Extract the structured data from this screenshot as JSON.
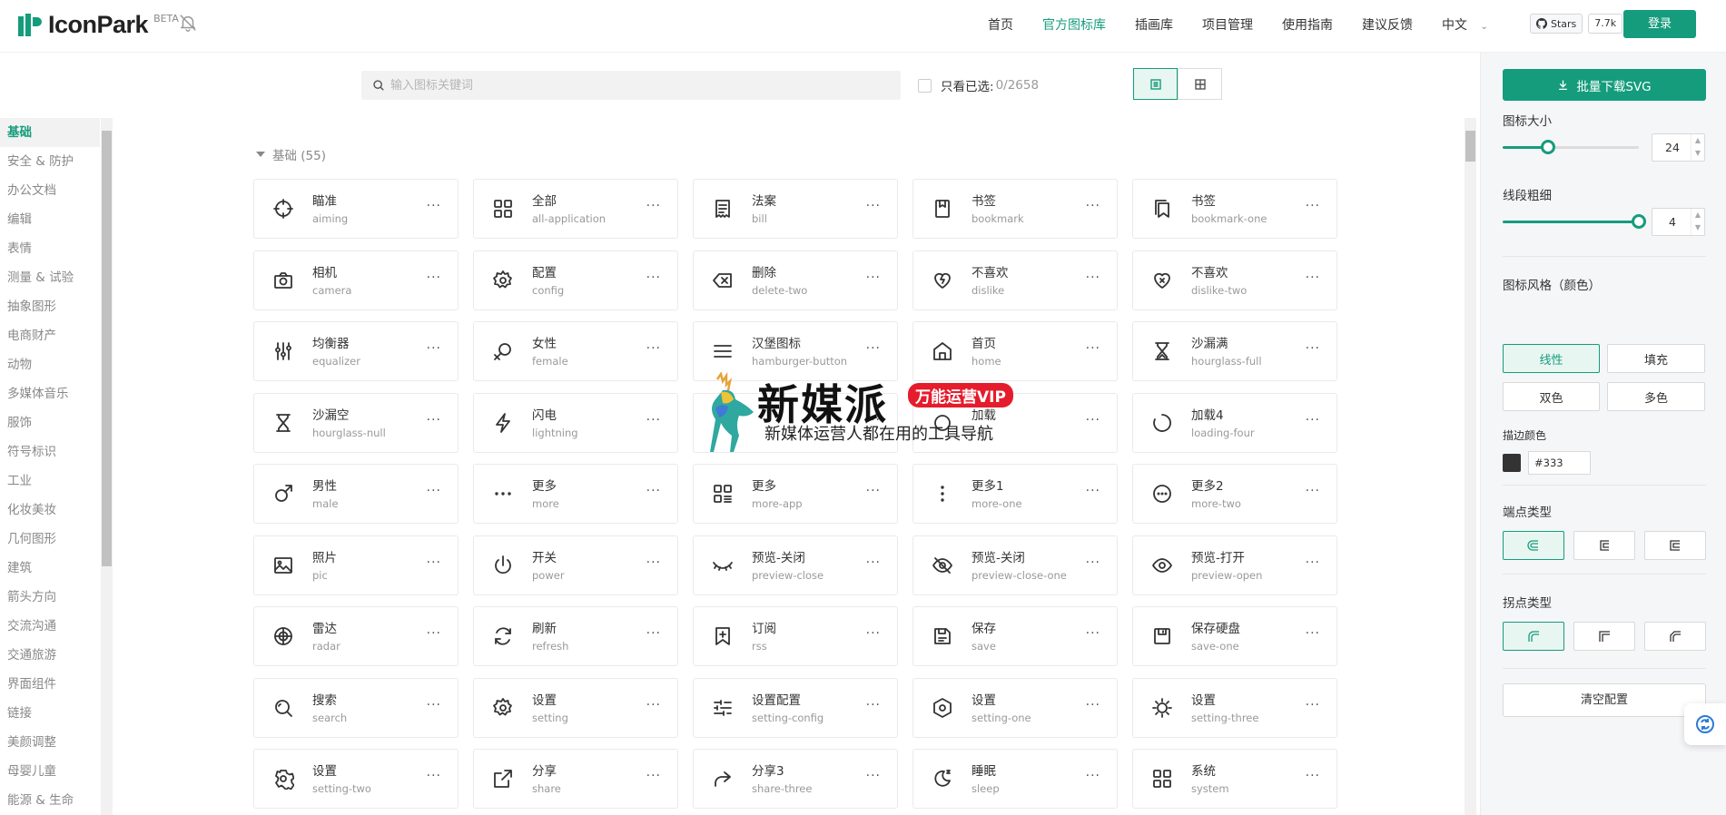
{
  "header": {
    "logo_text": "IconPark",
    "beta": "BETA",
    "nav": [
      {
        "label": "首页",
        "active": false
      },
      {
        "label": "官方图标库",
        "active": true
      },
      {
        "label": "插画库",
        "active": false
      },
      {
        "label": "项目管理",
        "active": false
      },
      {
        "label": "使用指南",
        "active": false
      },
      {
        "label": "建议反馈",
        "active": false
      },
      {
        "label": "中文",
        "active": false
      }
    ],
    "github_label": "Stars",
    "github_count": "7.7k",
    "login": "登录"
  },
  "sidebar": {
    "items": [
      "基础",
      "安全 & 防护",
      "办公文档",
      "编辑",
      "表情",
      "测量 & 试验",
      "抽象图形",
      "电商财产",
      "动物",
      "多媒体音乐",
      "服饰",
      "符号标识",
      "工业",
      "化妆美妆",
      "几何图形",
      "建筑",
      "箭头方向",
      "交流沟通",
      "交通旅游",
      "界面组件",
      "链接",
      "美颜调整",
      "母婴儿童",
      "能源 & 生命"
    ],
    "active_index": 0
  },
  "toolbar": {
    "search_placeholder": "输入图标关键词",
    "only_selected_label": "只看已选:",
    "selected_count": "0/2658"
  },
  "section": {
    "title": "基础 (55)"
  },
  "icons": [
    {
      "cn": "瞄准",
      "en": "aiming",
      "icon": "aiming-icon"
    },
    {
      "cn": "全部",
      "en": "all-application",
      "icon": "all-application-icon"
    },
    {
      "cn": "法案",
      "en": "bill",
      "icon": "bill-icon"
    },
    {
      "cn": "书签",
      "en": "bookmark",
      "icon": "bookmark-icon"
    },
    {
      "cn": "书签",
      "en": "bookmark-one",
      "icon": "bookmark-one-icon"
    },
    {
      "cn": "相机",
      "en": "camera",
      "icon": "camera-icon"
    },
    {
      "cn": "配置",
      "en": "config",
      "icon": "config-icon"
    },
    {
      "cn": "删除",
      "en": "delete-two",
      "icon": "delete-two-icon"
    },
    {
      "cn": "不喜欢",
      "en": "dislike",
      "icon": "dislike-icon"
    },
    {
      "cn": "不喜欢",
      "en": "dislike-two",
      "icon": "dislike-two-icon"
    },
    {
      "cn": "均衡器",
      "en": "equalizer",
      "icon": "equalizer-icon"
    },
    {
      "cn": "女性",
      "en": "female",
      "icon": "female-icon"
    },
    {
      "cn": "汉堡图标",
      "en": "hamburger-button",
      "icon": "hamburger-icon"
    },
    {
      "cn": "首页",
      "en": "home",
      "icon": "home-icon"
    },
    {
      "cn": "沙漏满",
      "en": "hourglass-full",
      "icon": "hourglass-full-icon"
    },
    {
      "cn": "沙漏空",
      "en": "hourglass-null",
      "icon": "hourglass-null-icon"
    },
    {
      "cn": "闪电",
      "en": "lightning",
      "icon": "lightning-icon"
    },
    {
      "cn": "",
      "en": "",
      "icon": "hidden-icon"
    },
    {
      "cn": "加载",
      "en": "",
      "icon": "loading-icon"
    },
    {
      "cn": "加载4",
      "en": "loading-four",
      "icon": "loading-four-icon"
    },
    {
      "cn": "男性",
      "en": "male",
      "icon": "male-icon"
    },
    {
      "cn": "更多",
      "en": "more",
      "icon": "more-icon"
    },
    {
      "cn": "更多",
      "en": "more-app",
      "icon": "more-app-icon"
    },
    {
      "cn": "更多1",
      "en": "more-one",
      "icon": "more-one-icon"
    },
    {
      "cn": "更多2",
      "en": "more-two",
      "icon": "more-two-icon"
    },
    {
      "cn": "照片",
      "en": "pic",
      "icon": "pic-icon"
    },
    {
      "cn": "开关",
      "en": "power",
      "icon": "power-icon"
    },
    {
      "cn": "预览-关闭",
      "en": "preview-close",
      "icon": "preview-close-icon"
    },
    {
      "cn": "预览-关闭",
      "en": "preview-close-one",
      "icon": "preview-close-one-icon"
    },
    {
      "cn": "预览-打开",
      "en": "preview-open",
      "icon": "preview-open-icon"
    },
    {
      "cn": "雷达",
      "en": "radar",
      "icon": "radar-icon"
    },
    {
      "cn": "刷新",
      "en": "refresh",
      "icon": "refresh-icon"
    },
    {
      "cn": "订阅",
      "en": "rss",
      "icon": "rss-icon"
    },
    {
      "cn": "保存",
      "en": "save",
      "icon": "save-icon"
    },
    {
      "cn": "保存硬盘",
      "en": "save-one",
      "icon": "save-one-icon"
    },
    {
      "cn": "搜索",
      "en": "search",
      "icon": "search-icon"
    },
    {
      "cn": "设置",
      "en": "setting",
      "icon": "setting-icon"
    },
    {
      "cn": "设置配置",
      "en": "setting-config",
      "icon": "setting-config-icon"
    },
    {
      "cn": "设置",
      "en": "setting-one",
      "icon": "setting-one-icon"
    },
    {
      "cn": "设置",
      "en": "setting-three",
      "icon": "setting-three-icon"
    },
    {
      "cn": "设置",
      "en": "setting-two",
      "icon": "setting-two-icon"
    },
    {
      "cn": "分享",
      "en": "share",
      "icon": "share-icon"
    },
    {
      "cn": "分享3",
      "en": "share-three",
      "icon": "share-three-icon"
    },
    {
      "cn": "睡眠",
      "en": "sleep",
      "icon": "sleep-icon"
    },
    {
      "cn": "系统",
      "en": "system",
      "icon": "system-icon"
    }
  ],
  "panel": {
    "download_label": "批量下载SVG",
    "size_label": "图标大小",
    "size_value": "24",
    "size_fraction": 0.33,
    "stroke_label": "线段粗细",
    "stroke_value": "4",
    "stroke_fraction": 1.0,
    "style_label": "图标风格（颜色）",
    "styles": [
      "线性",
      "填充",
      "双色",
      "多色"
    ],
    "style_active": 0,
    "stroke_color_label": "描边颜色",
    "stroke_color": "#333",
    "cap_label": "端点类型",
    "join_label": "拐点类型",
    "clear_label": "清空配置"
  },
  "watermark": {
    "brand": "新媒派",
    "vip": "万能运营VIP",
    "tagline": "新媒体运营人都在用的工具导航"
  },
  "colors": {
    "accent": "#159c7c",
    "accent_light": "#e8f6f1"
  }
}
